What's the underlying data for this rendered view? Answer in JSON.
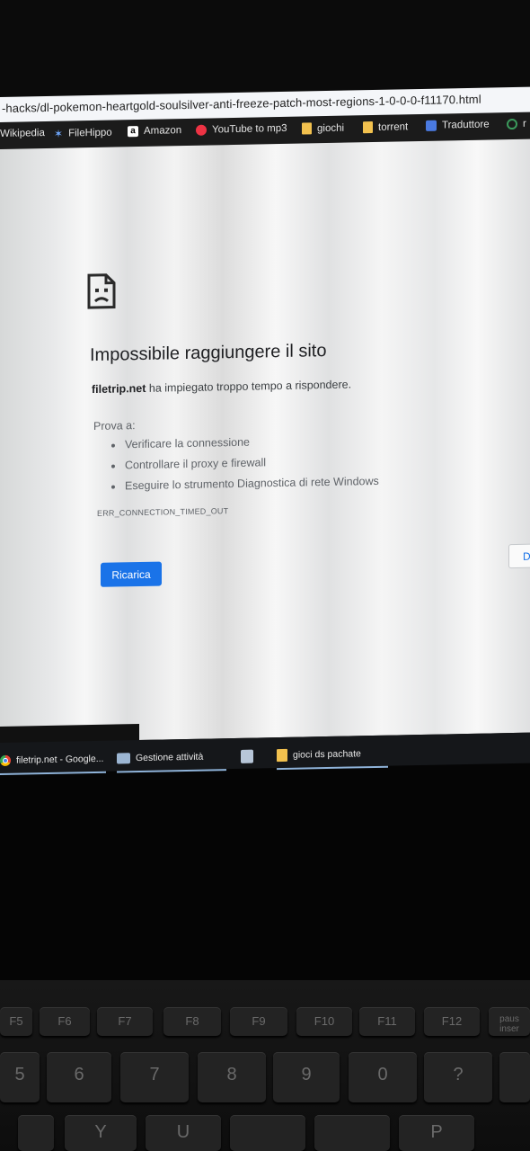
{
  "browser": {
    "url": "-hacks/dl-pokemon-heartgold-soulsilver-anti-freeze-patch-most-regions-1-0-0-0-f11170.html",
    "bookmarks": [
      {
        "label": "Wikipedia",
        "icon": "wikipedia-icon"
      },
      {
        "label": "FileHippo",
        "icon": "filehippo-icon"
      },
      {
        "label": "Amazon",
        "icon": "amazon-icon",
        "glyph": "a"
      },
      {
        "label": "YouTube to mp3",
        "icon": "youtube-to-mp3-icon"
      },
      {
        "label": "giochi",
        "icon": "folder-icon"
      },
      {
        "label": "torrent",
        "icon": "folder-icon"
      },
      {
        "label": "Traduttore",
        "icon": "translate-icon"
      },
      {
        "label": "r",
        "icon": "globe-icon"
      }
    ]
  },
  "error_page": {
    "title": "Impossibile raggiungere il sito",
    "host": "filetrip.net",
    "description": "ha impiegato troppo tempo a rispondere.",
    "try_label": "Prova a:",
    "suggestions": [
      "Verificare la connessione",
      "Controllare il proxy e firewall",
      "Eseguire lo strumento Diagnostica di rete Windows"
    ],
    "error_code": "ERR_CONNECTION_TIMED_OUT",
    "reload_label": "Ricarica",
    "details_label": "D"
  },
  "taskbar": {
    "items": [
      {
        "label": "filetrip.net - Google...",
        "icon": "chrome-icon"
      },
      {
        "label": "Gestione attività",
        "icon": "task-manager-icon"
      },
      {
        "label": "",
        "icon": "app-icon"
      },
      {
        "label": "gioci ds pachate",
        "icon": "folder-icon"
      }
    ]
  },
  "keyboard": {
    "fn_row": [
      "F5",
      "F6",
      "F7",
      "F8",
      "F9",
      "F10",
      "F11",
      "F12",
      "paus inser"
    ],
    "number_row": [
      "5",
      "6",
      "7",
      "8",
      "9",
      "0",
      "?"
    ],
    "letter_row": [
      "Y",
      "U",
      "P"
    ]
  }
}
